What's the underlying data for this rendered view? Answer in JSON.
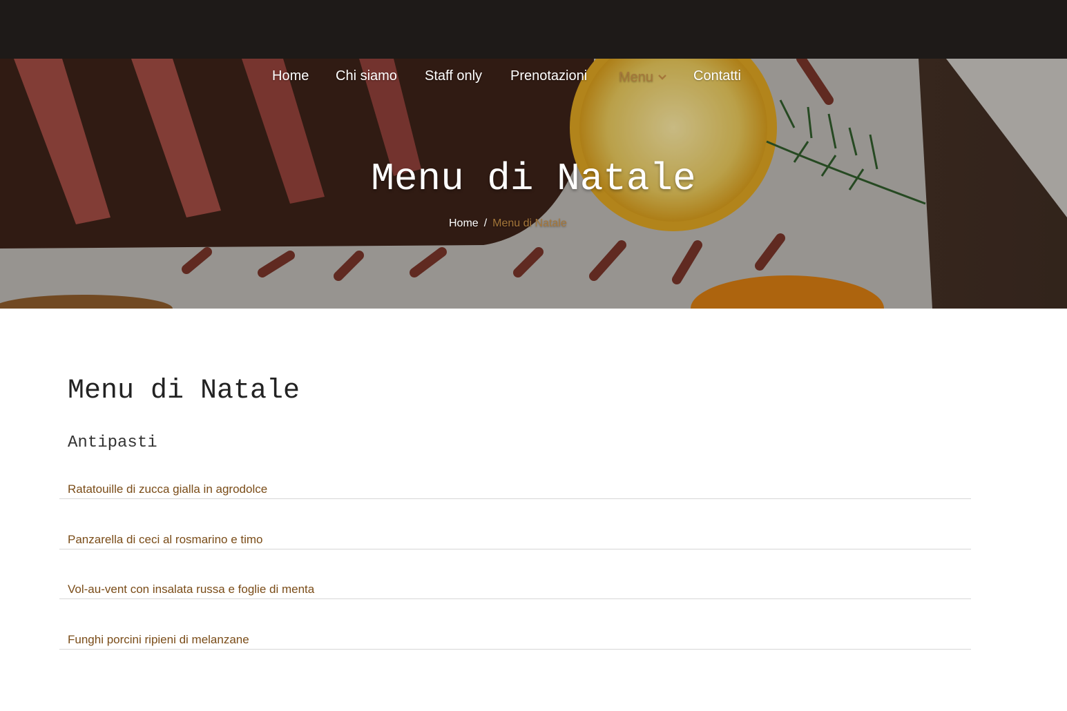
{
  "header": {
    "nav": [
      {
        "label": "Home",
        "active": false
      },
      {
        "label": "Chi siamo",
        "active": false
      },
      {
        "label": "Staff only",
        "active": false
      },
      {
        "label": "Prenotazioni",
        "active": false
      },
      {
        "label": "Menu",
        "active": true,
        "has_dropdown": true
      },
      {
        "label": "Contatti",
        "active": false
      }
    ]
  },
  "hero": {
    "title": "Menu di Natale",
    "breadcrumb": {
      "home": "Home",
      "separator": "/",
      "current": "Menu di Natale"
    }
  },
  "main": {
    "heading": "Menu di Natale",
    "section_title": "Antipasti",
    "items": [
      "Ratatouille di zucca gialla in agrodolce",
      "Panzarella di ceci al rosmarino e timo",
      "Vol-au-vent con insalata russa e foglie di menta",
      "Funghi porcini ripieni di melanzane"
    ]
  },
  "colors": {
    "topbar": "#1e1a18",
    "accent": "#a5773a",
    "item_text": "#7a4c18",
    "divider": "#d6d6d6"
  }
}
